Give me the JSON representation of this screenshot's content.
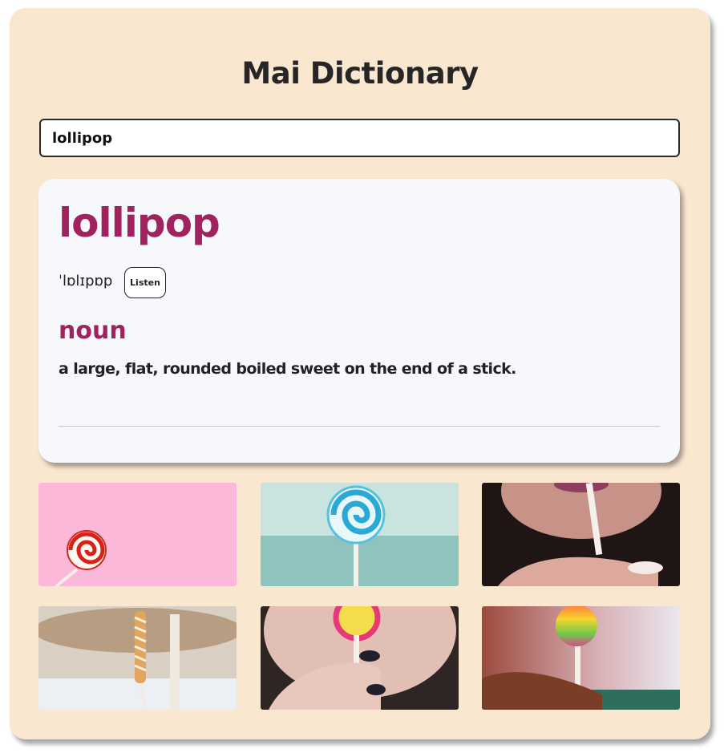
{
  "app": {
    "title": "Mai Dictionary"
  },
  "search": {
    "value": "lollipop"
  },
  "entry": {
    "word": "lollipop",
    "phonetic": "ˈlɒlɪpɒp",
    "listen_label": "Listen",
    "part_of_speech": "noun",
    "definition": "a large, flat, rounded boiled sweet on the end of a stick."
  },
  "colors": {
    "page_background": "#f9e7cf",
    "accent": "#a0235f",
    "card_background": "#f7f8fc"
  },
  "photos": [
    {
      "name": "red-white-swirl-lollipop-on-pink"
    },
    {
      "name": "blue-swirl-lollipop-on-mint"
    },
    {
      "name": "woman-holding-lollipop-stick"
    },
    {
      "name": "twisted-lollipop-carousel"
    },
    {
      "name": "woman-licking-lollipop"
    },
    {
      "name": "rainbow-lollipop-in-hand"
    }
  ]
}
